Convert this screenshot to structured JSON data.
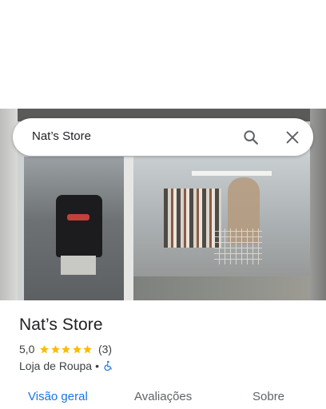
{
  "search": {
    "query": "Nat’s Store"
  },
  "place": {
    "title": "Nat’s Store",
    "rating": "5,0",
    "stars": 5,
    "review_count": "(3)",
    "category": "Loja de Roupa",
    "separator": "•"
  },
  "tabs": [
    {
      "label": "Visão geral",
      "active": true
    },
    {
      "label": "Avaliações",
      "active": false
    },
    {
      "label": "Sobre",
      "active": false
    }
  ],
  "colors": {
    "accent": "#1a73e8",
    "star": "#fbbc04"
  },
  "icons": {
    "search": "search-icon",
    "close": "close-icon",
    "accessibility": "wheelchair-accessible-icon"
  }
}
